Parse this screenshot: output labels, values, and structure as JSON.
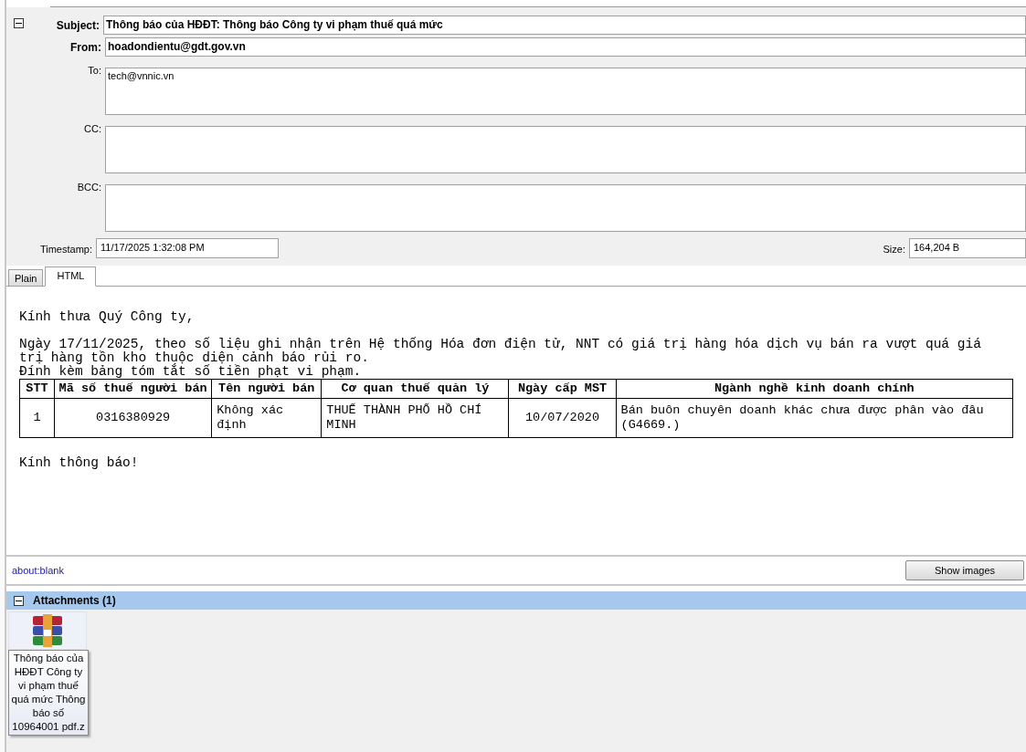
{
  "header": {
    "expanded": true,
    "fields": [
      {
        "label": "Subject:",
        "value": "Thông báo của HĐĐT: Thông báo Công ty vi phạm thuế quá mức",
        "kind": "line"
      },
      {
        "label": "From:",
        "value": "hoadondientu@gdt.gov.vn",
        "kind": "line"
      },
      {
        "label": "To:",
        "value": "tech@vnnic.vn",
        "kind": "area"
      },
      {
        "label": "CC:",
        "kind": "area"
      },
      {
        "label": "BCC:",
        "kind": "area"
      }
    ],
    "timestamp": {
      "label": "Timestamp:",
      "value": "11/17/2025 1:32:08 PM"
    },
    "size": {
      "label": "Size:",
      "value": "164,204 B"
    }
  },
  "tabs": [
    {
      "label": "Plain",
      "selected": false
    },
    {
      "label": "HTML",
      "selected": true
    }
  ],
  "body": {
    "greeting": "Kính thưa Quý Công ty,",
    "paragraphs": [
      "Ngày 17/11/2025, theo số liệu ghi nhận trên Hệ thống Hóa đơn điện tử, NNT có giá trị hàng hóa dịch vụ bán ra vượt quá giá trị hàng tồn kho thuộc diện cảnh báo rủi ro.",
      "Đính kèm bảng tóm tắt số tiền phạt vi phạm."
    ],
    "table": {
      "columns": [
        "STT",
        "Mã số thuế người bán",
        "Tên người bán",
        "Cơ quan thuế quản lý",
        "Ngày cấp MST",
        "Ngành nghề kinh doanh chính"
      ],
      "rows": [
        [
          "1",
          "0316380929",
          "Không xác định",
          "THUẾ THÀNH PHỐ HỒ CHÍ MINH",
          "10/07/2020",
          "Bán buôn chuyên doanh khác chưa được phân vào đâu (G4669.)"
        ]
      ]
    },
    "closing": "Kính thông báo!"
  },
  "status_bar": {
    "url": "about:blank",
    "button": "Show images"
  },
  "attachments": {
    "title": "Attachments (1)",
    "expanded": true,
    "items": [
      {
        "name": "Thông báo của HĐĐT Công ty vi phạm thuế quá mức Thông báo số 10964001 pdf.z"
      }
    ]
  }
}
